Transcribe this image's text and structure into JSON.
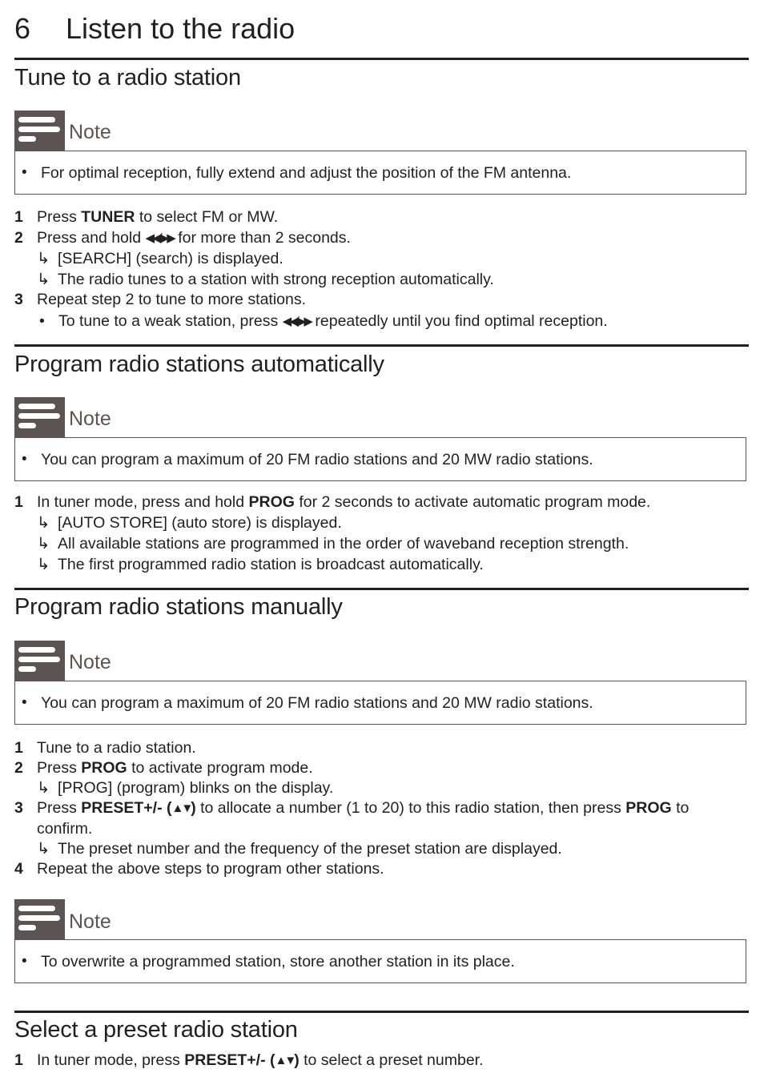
{
  "chapter": {
    "number": "6",
    "title": "Listen to the radio"
  },
  "icons": {
    "note": "note-lines-icon",
    "result_arrow": "hook-arrow-icon",
    "bullet": "bullet-icon",
    "prev_next": "rewind-forward-icon",
    "up_down": "up-down-triangle-icon"
  },
  "colors": {
    "note_tab": "#5c5452",
    "text": "#231f20",
    "rule": "#231f20"
  },
  "sections": [
    {
      "heading": "Tune to a radio station",
      "note": {
        "label": "Note",
        "items": [
          "For optimal reception, fully extend and adjust the position of the FM antenna."
        ]
      },
      "steps": [
        {
          "num": "1",
          "pre": "Press ",
          "bold": "TUNER",
          "post": " to select FM or MW."
        },
        {
          "num": "2",
          "pre": "Press and hold ",
          "glyph": "◀◀/▶▶",
          "post": " for more than 2 seconds.",
          "results": [
            "[SEARCH] (search) is displayed.",
            "The radio tunes to a station with strong reception automatically."
          ]
        },
        {
          "num": "3",
          "text": "Repeat step 2 to tune to more stations.",
          "bullets": [
            {
              "pre": "To tune to a weak station, press ",
              "glyph": "◀◀/▶▶",
              "post": " repeatedly until you find optimal reception."
            }
          ]
        }
      ]
    },
    {
      "heading": "Program radio stations automatically",
      "note": {
        "label": "Note",
        "items": [
          "You can program a maximum of 20 FM radio stations and 20 MW radio stations."
        ]
      },
      "steps": [
        {
          "num": "1",
          "pre": "In tuner mode, press and hold ",
          "bold": "PROG",
          "post": " for 2 seconds to activate automatic program mode.",
          "results": [
            "[AUTO STORE] (auto store) is displayed.",
            "All available stations are programmed in the order of waveband reception strength.",
            "The first programmed radio station is broadcast automatically."
          ]
        }
      ]
    },
    {
      "heading": "Program radio stations manually",
      "note": {
        "label": "Note",
        "items": [
          "You can program a maximum of 20 FM radio stations and 20 MW radio stations."
        ]
      },
      "steps": [
        {
          "num": "1",
          "text": "Tune to a radio station."
        },
        {
          "num": "2",
          "pre": "Press ",
          "bold": "PROG",
          "post": " to activate program mode.",
          "results": [
            "[PROG] (program) blinks on the display."
          ]
        },
        {
          "num": "3",
          "pre": "Press ",
          "bold": "PRESET+/- (",
          "glyph": "▲▼",
          "bold2": ")",
          "mid": " to allocate a number (1 to 20) to this radio station, then press ",
          "bold3": "PROG",
          "post": " to",
          "cont": "confirm.",
          "results": [
            "The preset number and the frequency of the preset station are displayed."
          ]
        },
        {
          "num": "4",
          "text": "Repeat the above steps to program other stations."
        }
      ],
      "note2": {
        "label": "Note",
        "items": [
          "To overwrite a programmed station, store another station in its place."
        ]
      }
    },
    {
      "heading": "Select a preset radio station",
      "steps": [
        {
          "num": "1",
          "pre": "In tuner mode, press ",
          "bold": "PRESET+/- (",
          "glyph": "▲▼",
          "bold2": ")",
          "post": " to select a preset number."
        }
      ]
    }
  ],
  "symbols": {
    "bullet": "•",
    "arrow": "↳"
  }
}
